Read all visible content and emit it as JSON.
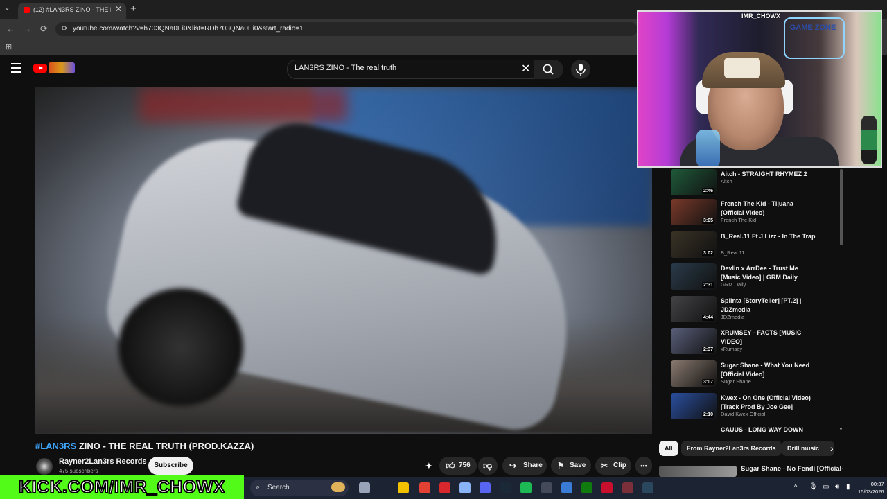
{
  "browser": {
    "tab_title": "(12) #LAN3RS ZINO - THE REAL",
    "tab_close": "✕",
    "new_tab": "+",
    "url": "youtube.com/watch?v=h703QNa0Ei0&list=RDh703QNa0Ei0&start_radio=1"
  },
  "header": {
    "search_value": "LAN3RS ZINO - The real truth"
  },
  "video": {
    "title_hashtag": "#LAN3RS",
    "title_rest": " ZINO - THE REAL TRUTH (PROD.KAZZA)",
    "channel_name": "Rayner2Lan3rs Records",
    "subscribers": "475 subscribers",
    "subscribe_label": "Subscribe",
    "likes": "756",
    "share_label": "Share",
    "save_label": "Save",
    "clip_label": "Clip",
    "more_label": "•••"
  },
  "recommendations": [
    {
      "title": "Aitch - STRAIGHT RHYMEZ 2",
      "channel": "Aitch",
      "duration": "2:46",
      "color": "#1f5a3a"
    },
    {
      "title": "French The Kid - Tijuana (Official Video)",
      "channel": "French The Kid",
      "duration": "3:05",
      "color": "#7a3a2a"
    },
    {
      "title": "B_Real.11 Ft J Lizz - In The Trap",
      "channel": "B_Real.11",
      "duration": "3:02",
      "color": "#3a3326"
    },
    {
      "title": "Devlin x ArrDee - Trust Me [Music Video] | GRM Daily",
      "channel": "GRM Daily",
      "duration": "2:31",
      "color": "#2a3b4a"
    },
    {
      "title": "Splinta [StoryTeller] [PT.2] | JDZmedia",
      "channel": "JDZmedia",
      "duration": "4:44",
      "color": "#444448"
    },
    {
      "title": "XRUMSEY - FACTS [MUSIC VIDEO]",
      "channel": "xRumsey",
      "duration": "2:37",
      "color": "#5a5f7a"
    },
    {
      "title": "Sugar Shane - What You Need [Official Video]",
      "channel": "Sugar Shane",
      "duration": "3:07",
      "color": "#8a7a70"
    },
    {
      "title": "Kwex - On One (Official Video) [Track Prod By Joe Gee]",
      "channel": "David Kwex Official",
      "duration": "2:10",
      "color": "#2a4fa0"
    },
    {
      "title": "CAUUS - LONG WAY DOWN",
      "channel": "",
      "duration": "",
      "color": "#333"
    }
  ],
  "chips": [
    "All",
    "From Rayner2Lan3rs Records",
    "Drill music"
  ],
  "bottom_rec": {
    "title": "Sugar Shane - No Fendi [Official"
  },
  "overlay": {
    "cam_name": "IMR_CHOWX",
    "cam_sign": "GAME ZONE",
    "kick_text": "KICK.COM/IMR_CHOWX"
  },
  "taskbar": {
    "search_label": "Search",
    "time": "00:37",
    "date": "15/03/2026"
  }
}
